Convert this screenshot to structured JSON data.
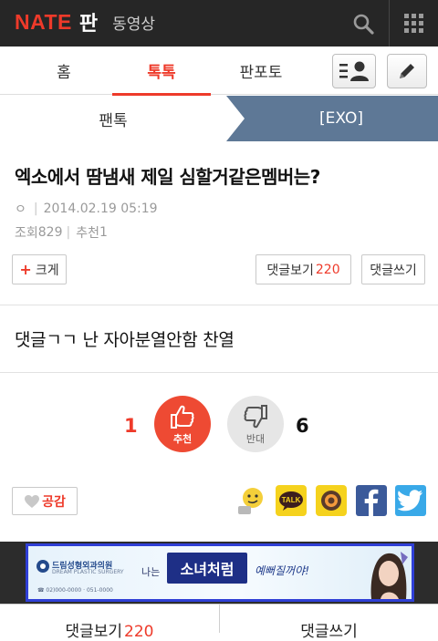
{
  "header": {
    "logo_nate": "NATE",
    "logo_pan": "판",
    "video_label": "동영상",
    "icons": [
      "search-icon",
      "grid-menu-icon"
    ]
  },
  "tabs": {
    "home": "홈",
    "toktok": "톡톡",
    "panpoto": "판포토",
    "active": "톡톡",
    "buttons": [
      "profile-list-icon",
      "pencil-icon"
    ]
  },
  "breadcrumb": {
    "parent": "팬톡",
    "current": "[EXO]"
  },
  "article": {
    "title": "엑소에서 땀냄새 제일 심할거같은멤버는?",
    "author_marker": "ㅇ",
    "datetime": "2014.02.19 05:19",
    "views_label": "조회",
    "views": "829",
    "recommend_label": "추천",
    "recommend": "1",
    "body": "댓글ㄱㄱ 난 자아분열안함 찬열"
  },
  "actions": {
    "enlarge": "크게",
    "view_comments": "댓글보기",
    "comment_count": "220",
    "write_comment": "댓글쓰기"
  },
  "vote": {
    "up_count": "1",
    "up_label": "추천",
    "down_label": "반대",
    "down_count": "6"
  },
  "share": {
    "like_label": "공감",
    "talk_label": "TALK",
    "targets": [
      "emoji-share-icon",
      "kakaotalk-icon",
      "kakaostory-icon",
      "facebook-icon",
      "twitter-icon"
    ]
  },
  "ad": {
    "hospital": "드림성형외과의원",
    "hospital_en": "DREAM PLASTIC SURGERY",
    "phone": "☎ 02)000-0000 · 051-0000",
    "naneun": "나는",
    "headline": "소녀처럼",
    "tail": "예뻐질꺼야!"
  },
  "bottom": {
    "view_comments": "댓글보기",
    "comment_count": "220",
    "write_comment": "댓글쓰기"
  },
  "colors": {
    "accent": "#ee3a2a",
    "header_bg": "#262626",
    "crumb_blue": "#5e7896"
  }
}
